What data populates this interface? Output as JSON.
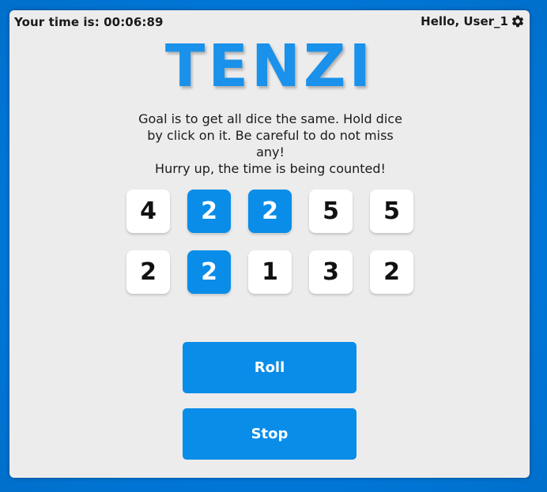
{
  "header": {
    "timer_text": "Your time is: 00:06:89",
    "greeting": "Hello, User_1",
    "settings_icon": "gear-icon"
  },
  "title": "TENZI",
  "instructions": {
    "line1": "Goal is to get all dice the same. Hold dice by click on it. Be careful to do not miss any!",
    "line2": "Hurry up, the time is being counted!"
  },
  "dice": [
    {
      "value": "4",
      "held": false
    },
    {
      "value": "2",
      "held": true
    },
    {
      "value": "2",
      "held": true
    },
    {
      "value": "5",
      "held": false
    },
    {
      "value": "5",
      "held": false
    },
    {
      "value": "2",
      "held": false
    },
    {
      "value": "2",
      "held": true
    },
    {
      "value": "1",
      "held": false
    },
    {
      "value": "3",
      "held": false
    },
    {
      "value": "2",
      "held": false
    }
  ],
  "buttons": {
    "roll": "Roll",
    "stop": "Stop"
  },
  "colors": {
    "accent": "#0a8de8",
    "background": "#0077d9",
    "panel": "#ececec"
  }
}
